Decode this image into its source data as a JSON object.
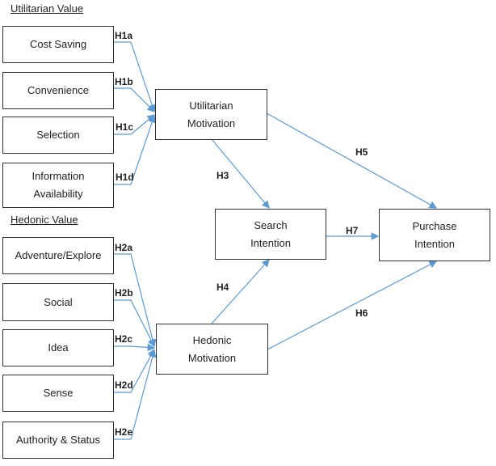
{
  "groups": {
    "utilitarian": "Utilitarian  Value",
    "hedonic": "Hedonic  Value"
  },
  "utilitarian_items": [
    "Cost Saving",
    "Convenience",
    "Selection",
    "Information\nAvailability"
  ],
  "hedonic_items": [
    "Adventure/Explore",
    "Social",
    "Idea",
    "Sense",
    "Authority & Status"
  ],
  "constructs": {
    "utilitarian_motivation": "Utilitarian\nMotivation",
    "hedonic_motivation": "Hedonic\nMotivation",
    "search_intention": "Search\nIntention",
    "purchase_intention": "Purchase\nIntention"
  },
  "hypotheses": {
    "H1a": "H1a",
    "H1b": "H1b",
    "H1c": "H1c",
    "H1d": "H1d",
    "H2a": "H2a",
    "H2b": "H2b",
    "H2c": "H2c",
    "H2d": "H2d",
    "H2e": "H2e",
    "H3": "H3",
    "H4": "H4",
    "H5": "H5",
    "H6": "H6",
    "H7": "H7"
  },
  "colors": {
    "arrow": "#5b9bd5",
    "border": "#333333"
  }
}
